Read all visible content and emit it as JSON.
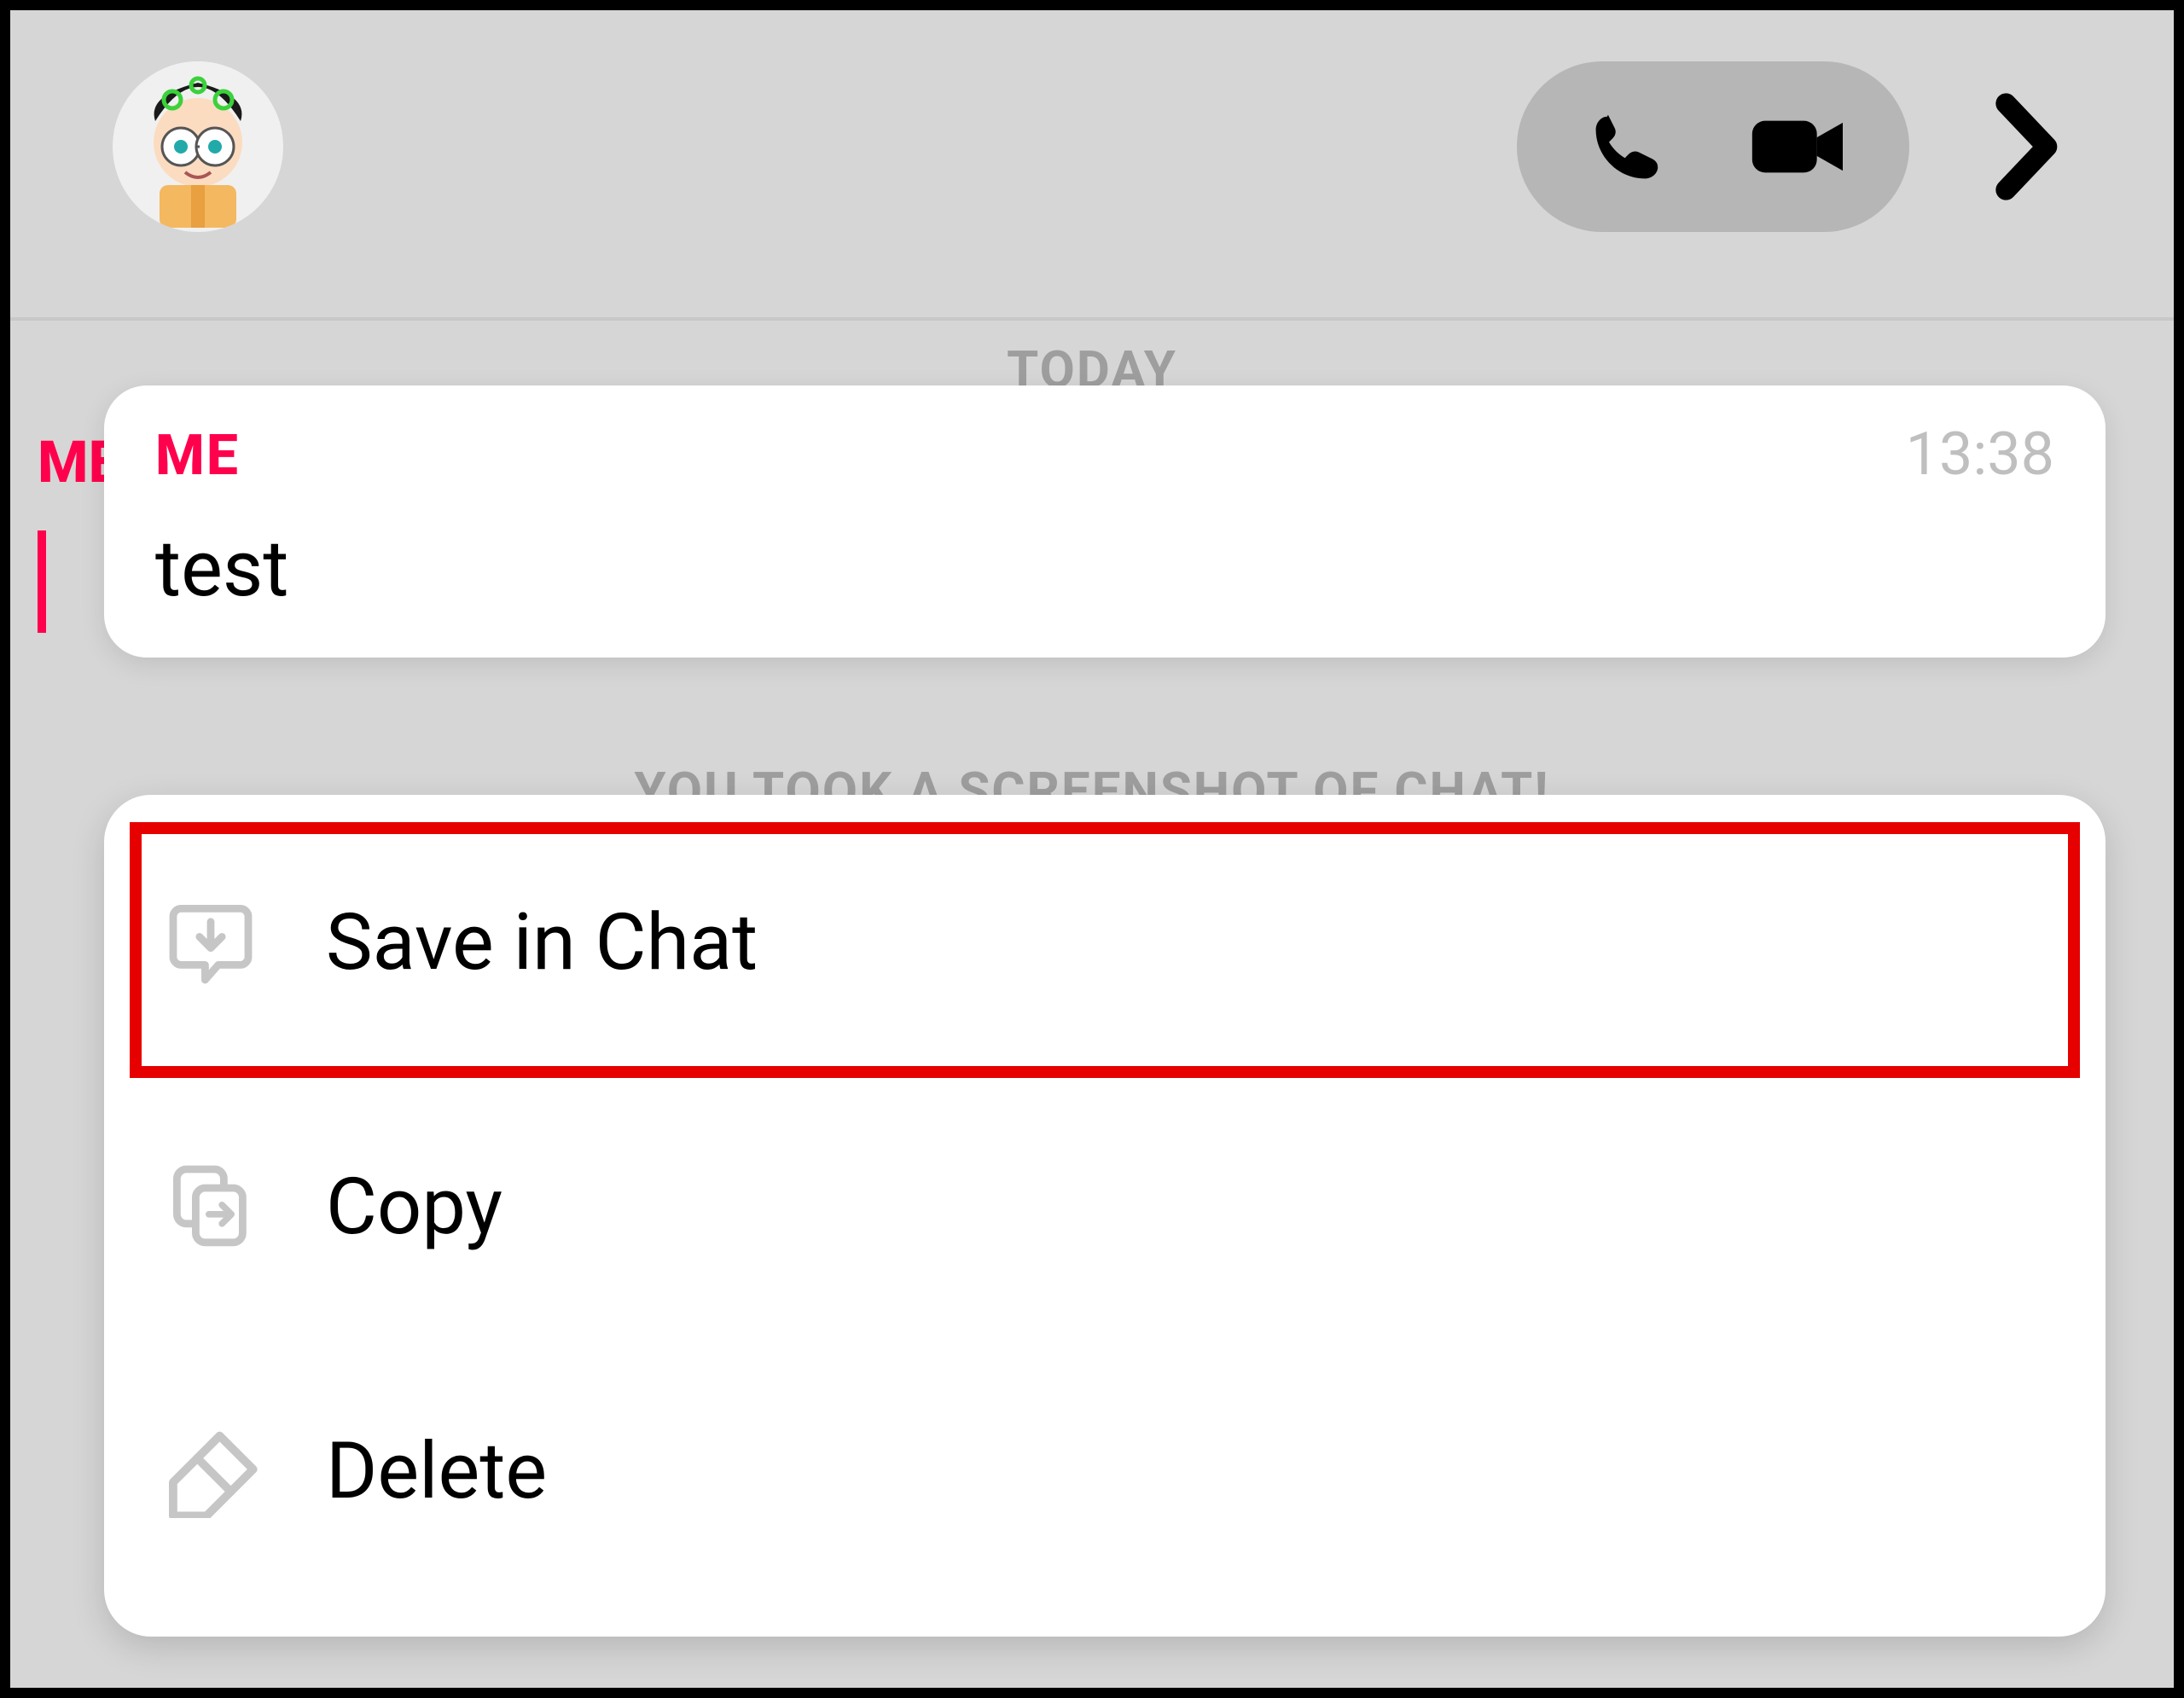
{
  "header": {
    "avatar_name": "friend-avatar",
    "audio_call_label": "Audio Call",
    "video_call_label": "Video Call"
  },
  "background": {
    "date_label": "TODAY",
    "me_label": "ME",
    "screenshot_note": "YOU TOOK A SCREENSHOT OF CHAT!"
  },
  "message": {
    "sender": "ME",
    "time": "13:38",
    "text": "test"
  },
  "actions": {
    "save": "Save in Chat",
    "copy": "Copy",
    "delete": "Delete"
  },
  "colors": {
    "accent_red": "#ff004c",
    "highlight_red": "#e60000",
    "bg_grey": "#d6d6d6",
    "icon_grey": "#c6c6c6"
  }
}
